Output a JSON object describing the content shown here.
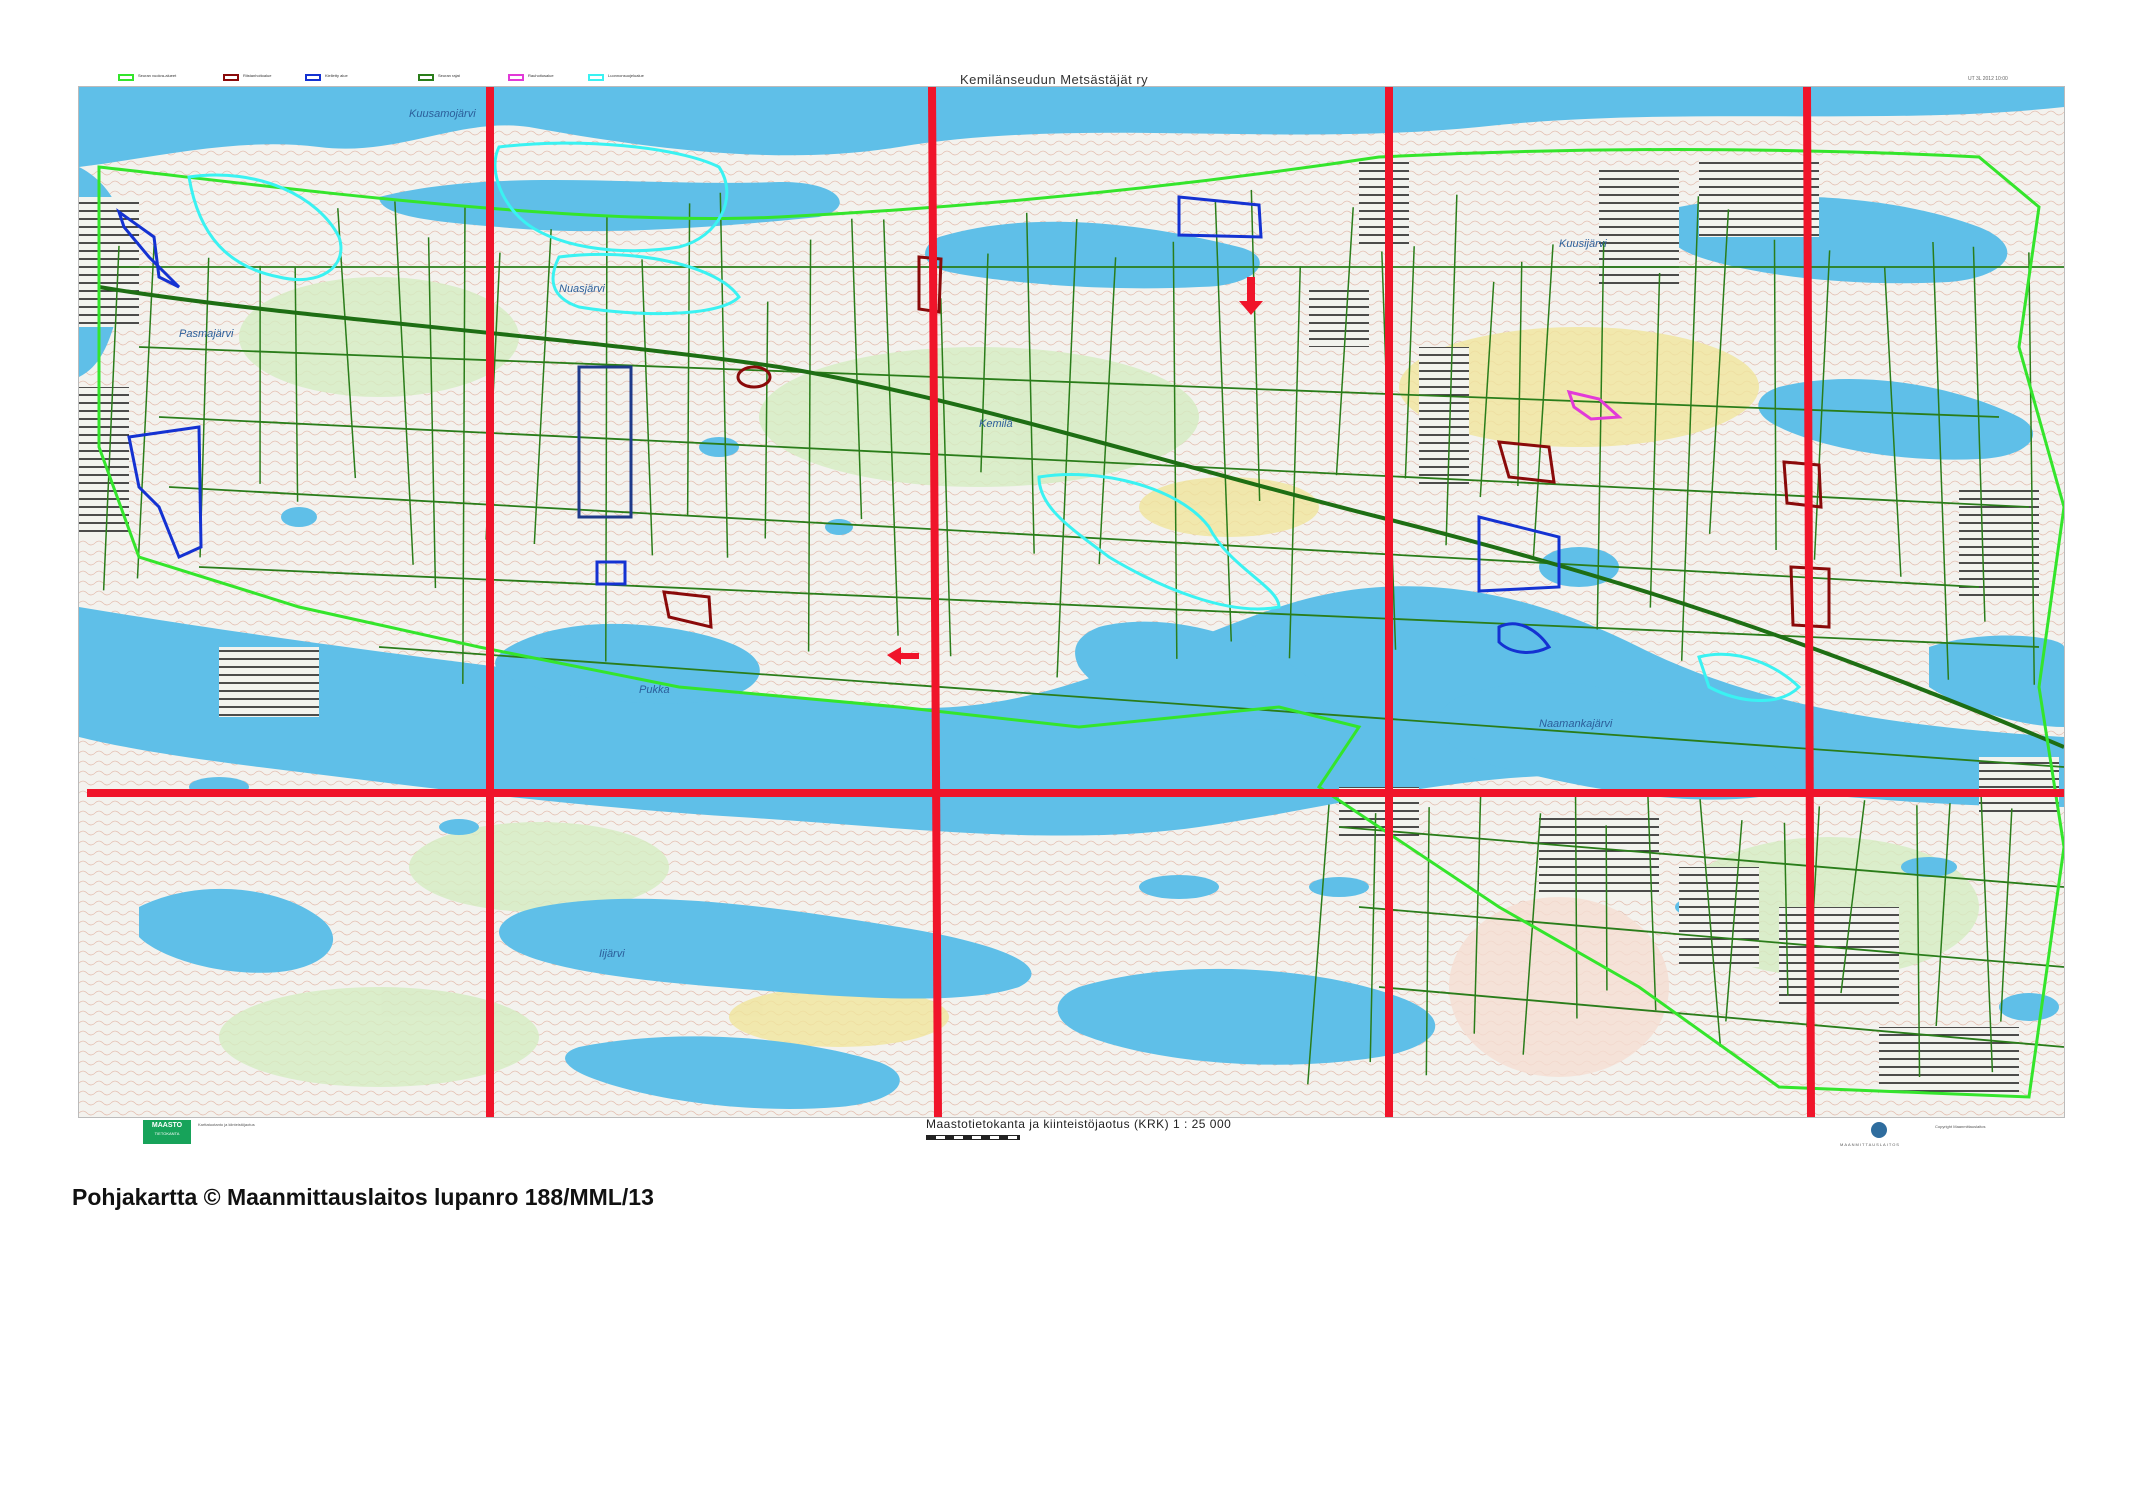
{
  "map": {
    "title": "Kemilänseudun Metsästäjät ry",
    "sheet_id": "UT 3L 2012 10:00",
    "scale_text": "Maastotietokanta ja kiinteistöjaotus (KRK) 1 : 25 000",
    "copyright": "Pohjakartta © Maanmittauslaitos lupanro 188/MML/13",
    "logo_text": "MAASTO",
    "logo_sub": "TIETOKANTA",
    "footer_note": "Karttatuotanto ja kiinteistöjaotus",
    "mml_text": "MAANMITTAUSLAITOS",
    "copyright_small": "Copyright Maanmittauslaitos",
    "colors": {
      "water": "#5fbfe8",
      "land": "#f2f3ee",
      "forest_green": "#c9e7b0",
      "field_yellow": "#f0e59c",
      "grid_red": "#f0142a",
      "boundary_green": "#2a7d1a",
      "area_green": "#34e52c",
      "cyan": "#3af2f2",
      "blue": "#1432d2",
      "dark_red": "#8a0a0a",
      "magenta": "#e23ad8"
    },
    "legend": [
      {
        "label": "Seuran vuokra-alueet",
        "color": "#34e52c"
      },
      {
        "label": "Riistanhoitoalue",
        "color": "#8a0a0a"
      },
      {
        "label": "Kielletty alue",
        "color": "#1432d2"
      },
      {
        "label": "Seuran rajat",
        "color": "#2a7d1a"
      },
      {
        "label": "Rauhoitusalue",
        "color": "#e23ad8"
      },
      {
        "label": "Luonnonsuojelualue",
        "color": "#3af2f2"
      }
    ],
    "place_labels": [
      "Kuusamojärvi",
      "Nuasjärvi",
      "Naamankajärvi",
      "Iijärvi",
      "Pasmajärvi",
      "Kemilä",
      "Pukka",
      "Kuusijärvi"
    ]
  }
}
